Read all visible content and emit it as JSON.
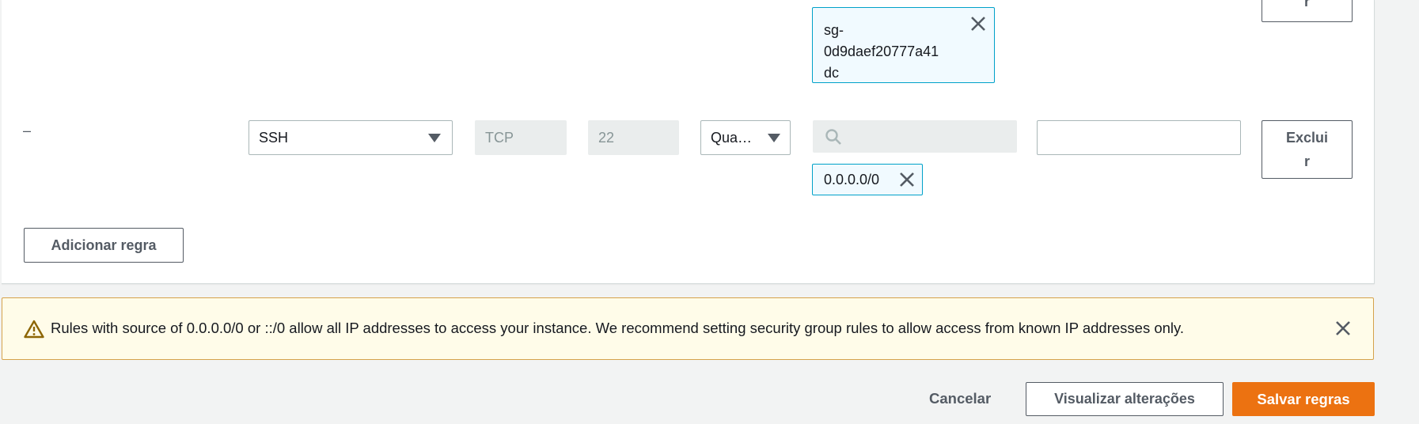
{
  "rules": {
    "prev_row": {
      "source_token": [
        "sg-",
        "0d9daef20777a41",
        "dc"
      ],
      "delete_label_tail": "r"
    },
    "row": {
      "dash": "–",
      "type_value": "SSH",
      "protocol_value": "TCP",
      "port_value": "22",
      "source_type_value": "Qua…",
      "source_search_value": "",
      "source_token": "0.0.0.0/0",
      "description_value": "",
      "delete_label": [
        "Exclui",
        "r"
      ]
    },
    "add_rule_label": "Adicionar regra"
  },
  "warning": {
    "message": "Rules with source of 0.0.0.0/0 or ::/0 allow all IP addresses to access your instance. We recommend setting security group rules to allow access from known IP addresses only.",
    "icon": "warning-triangle-icon",
    "close_icon": "close-icon"
  },
  "footer": {
    "cancel_label": "Cancelar",
    "preview_label": "Visualizar alterações",
    "save_label": "Salvar regras"
  },
  "colors": {
    "primary": "#ec7211",
    "token_border": "#00a1c9",
    "token_bg": "#f1faff",
    "warning_bg": "#fffce9",
    "warning_border": "#d5a24b",
    "page_bg": "#f2f3f3"
  }
}
